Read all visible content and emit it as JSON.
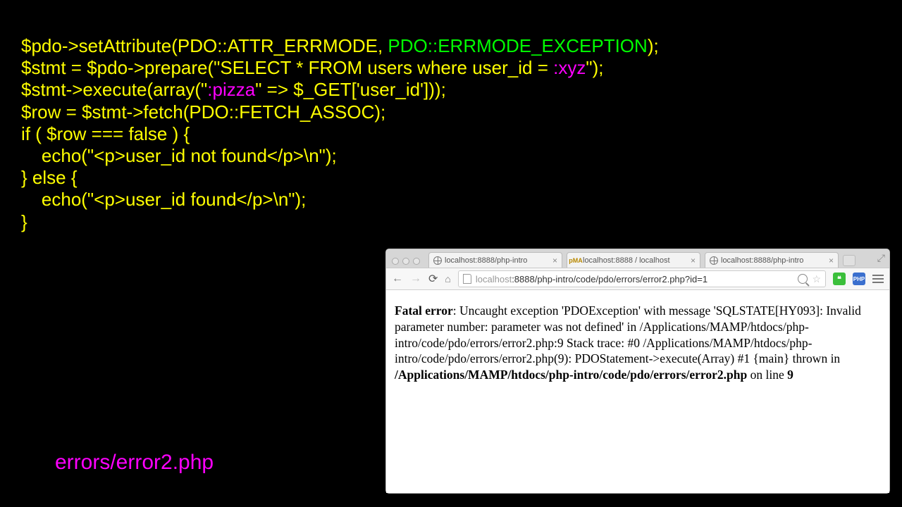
{
  "code": {
    "line1_a": "$pdo->setAttribute(PDO::ATTR_ERRMODE, ",
    "line1_b": "PDO::ERRMODE_EXCEPTION",
    "line1_c": ");",
    "line2_a": "$stmt = $pdo->prepare(\"SELECT * FROM users where user_id = ",
    "line2_b": ":xyz",
    "line2_c": "\");",
    "line3_a": "$stmt->execute(array(\"",
    "line3_b": ":pizza",
    "line3_c": "\" => $_GET['user_id']));",
    "line4": "$row = $stmt->fetch(PDO::FETCH_ASSOC);",
    "line5": "if ( $row === false ) {",
    "line6": "    echo(\"<p>user_id not found</p>\\n\");",
    "line7": "} else {",
    "line8": "    echo(\"<p>user_id found</p>\\n\");",
    "line9": "}"
  },
  "filename": "errors/error2.php",
  "browser": {
    "tabs": [
      {
        "label": "localhost:8888/php-intro",
        "favicon": "globe"
      },
      {
        "label": "localhost:8888 / localhost",
        "favicon": "pma"
      },
      {
        "label": "localhost:8888/php-intro",
        "favicon": "globe"
      }
    ],
    "url_host": "localhost",
    "url_port_path": ":8888/php-intro/code/pdo/errors/error2.php?id=1",
    "error": {
      "prefix": "Fatal error",
      "body1": ": Uncaught exception 'PDOException' with message 'SQLSTATE[HY093]: Invalid parameter number: parameter was not defined' in /Applications/MAMP/htdocs/php-intro/code/pdo/errors/error2.php:9 Stack trace: #0 /Applications/MAMP/htdocs/php-intro/code/pdo/errors/error2.php(9): PDOStatement->execute(Array) #1 {main} thrown in ",
      "bold_path": "/Applications/MAMP/htdocs/php-intro/code/pdo/errors/error2.php",
      "body2": " on line ",
      "bold_line": "9"
    }
  }
}
